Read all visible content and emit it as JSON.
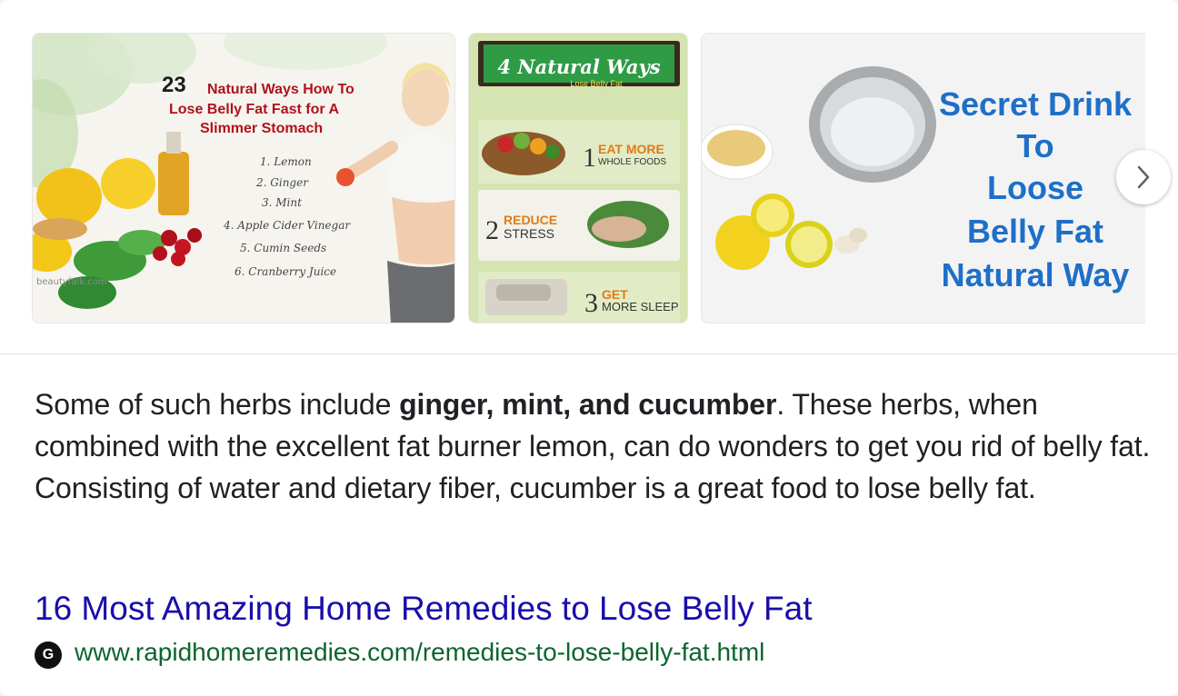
{
  "images": [
    {
      "headline_number": "23",
      "headline_rest": "Natural Ways How To",
      "headline_line2": "Lose Belly Fat Fast for A",
      "headline_line3": "Slimmer Stomach",
      "list": [
        "1. Lemon",
        "2. Ginger",
        "3. Mint",
        "4. Apple Cider Vinegar",
        "5. Cumin Seeds",
        "6. Cranberry Juice"
      ],
      "watermark": "beautyfalk.com"
    },
    {
      "banner_title": "4 Natural Ways",
      "banner_subtitle": "Lose Belly Fat",
      "items": [
        {
          "num": "1",
          "title": "EAT MORE",
          "sub": "WHOLE FOODS"
        },
        {
          "num": "2",
          "title": "REDUCE",
          "sub": "STRESS"
        },
        {
          "num": "3",
          "title": "GET",
          "sub": "MORE SLEEP"
        }
      ]
    },
    {
      "lines": [
        "Secret Drink",
        "To",
        "Loose",
        "Belly Fat",
        "Natural Way"
      ]
    }
  ],
  "snippet": {
    "before": "Some of such herbs include ",
    "bold": "ginger, mint, and cucumber",
    "after": ". These herbs, when combined with the excellent fat burner lemon, can do wonders to get you rid of belly fat. Consisting of water and dietary fiber, cucumber is a great food to lose belly fat."
  },
  "result": {
    "title": "16 Most Amazing Home Remedies to Lose Belly Fat",
    "favicon_letter": "G",
    "url": "www.rapidhomeremedies.com/remedies-to-lose-belly-fat.html"
  },
  "colors": {
    "link": "#1a0dab",
    "url": "#0d652d",
    "text": "#202124",
    "banner_green": "#2f9b45",
    "accent_orange": "#e07b16",
    "headline_red": "#b0121b",
    "image3_blue": "#1e6fc8"
  },
  "icons": {
    "next": "chevron-right-icon",
    "favicon": "globe-favicon"
  }
}
